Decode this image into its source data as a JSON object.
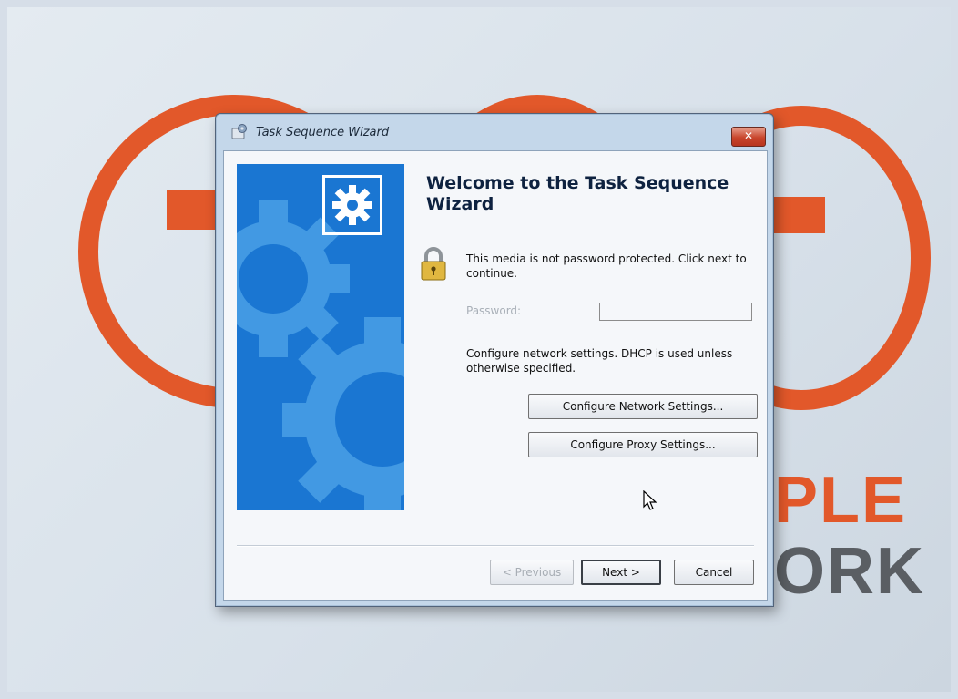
{
  "background": {
    "brand_word_1": "PLE",
    "brand_word_2": "ORK",
    "accent_color": "#e2582a",
    "gray_color": "#5a5e63"
  },
  "window": {
    "title": "Task Sequence Wizard",
    "title_icon": "wizard-app-icon",
    "close_label": "✕"
  },
  "content": {
    "heading": "Welcome to the Task Sequence Wizard",
    "password_message_line1": "This media is not password protected.  Click next to",
    "password_message_line2": "continue.",
    "password_label": "Password:",
    "password_value": "",
    "network_message_line1": "Configure network settings. DHCP is used unless",
    "network_message_line2": "otherwise specified.",
    "configure_network_label": "Configure Network Settings...",
    "configure_proxy_label": "Configure Proxy Settings..."
  },
  "footer": {
    "previous_label": "< Previous",
    "next_label": "Next >",
    "cancel_label": "Cancel"
  },
  "icons": {
    "side_panel": "gear-icon",
    "lock": "lock-icon",
    "cursor": "mouse-cursor-icon"
  },
  "colors": {
    "side_panel": "#1a76d2",
    "close_button": "#c8452c"
  }
}
